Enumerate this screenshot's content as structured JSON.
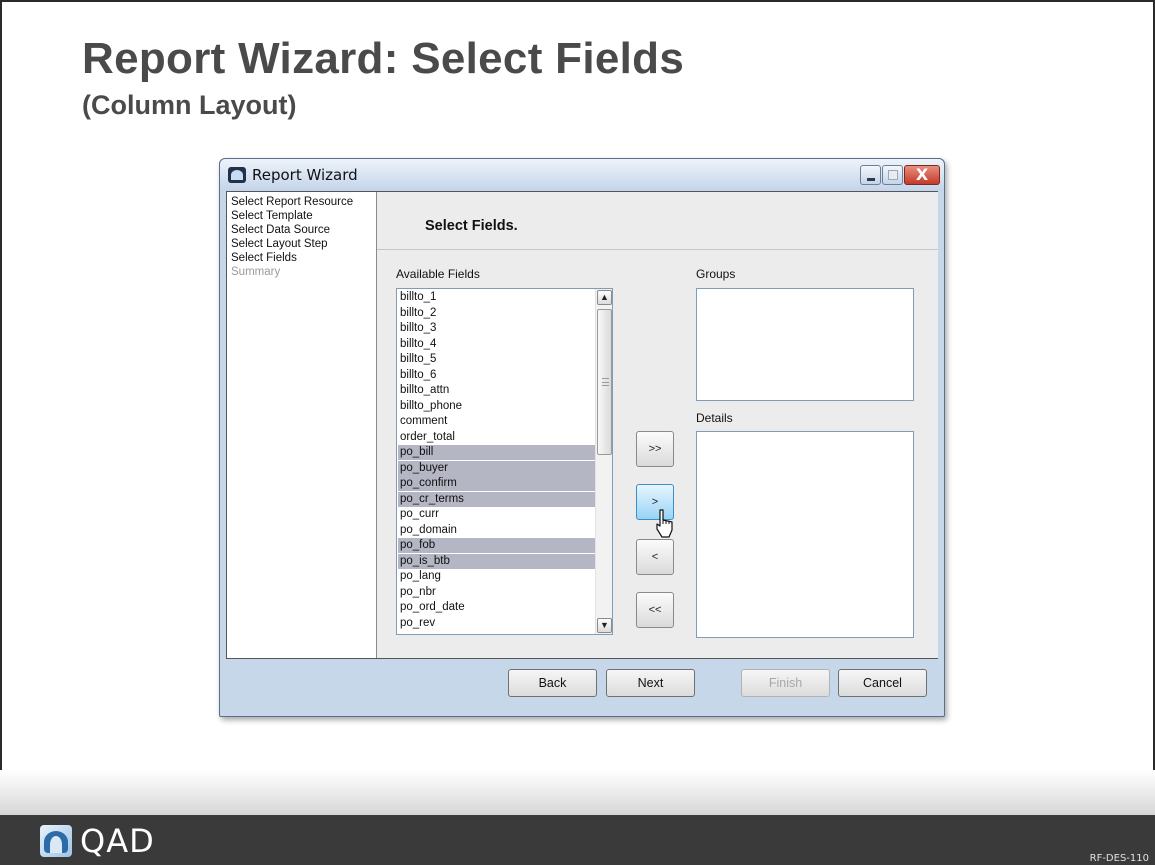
{
  "slide": {
    "title": "Report Wizard: Select Fields",
    "subtitle": "(Column Layout)",
    "logo_text": "QAD",
    "course_code": "RF-DES-110"
  },
  "window": {
    "title": "Report Wizard",
    "close_glyph": "X"
  },
  "steps": [
    {
      "label": "Select Report Resource",
      "enabled": true
    },
    {
      "label": "Select Template",
      "enabled": true
    },
    {
      "label": "Select Data Source",
      "enabled": true
    },
    {
      "label": "Select Layout Step",
      "enabled": true
    },
    {
      "label": "Select Fields",
      "enabled": true
    },
    {
      "label": "Summary",
      "enabled": false
    }
  ],
  "content": {
    "header_title": "Select Fields.",
    "available_label": "Available Fields",
    "groups_label": "Groups",
    "details_label": "Details"
  },
  "available_fields": [
    {
      "name": "billto_1",
      "selected": false
    },
    {
      "name": "billto_2",
      "selected": false
    },
    {
      "name": "billto_3",
      "selected": false
    },
    {
      "name": "billto_4",
      "selected": false
    },
    {
      "name": "billto_5",
      "selected": false
    },
    {
      "name": "billto_6",
      "selected": false
    },
    {
      "name": "billto_attn",
      "selected": false
    },
    {
      "name": "billto_phone",
      "selected": false
    },
    {
      "name": "comment",
      "selected": false
    },
    {
      "name": "order_total",
      "selected": false
    },
    {
      "name": "po_bill",
      "selected": true
    },
    {
      "name": "po_buyer",
      "selected": true
    },
    {
      "name": "po_confirm",
      "selected": true
    },
    {
      "name": "po_cr_terms",
      "selected": true
    },
    {
      "name": "po_curr",
      "selected": false
    },
    {
      "name": "po_domain",
      "selected": false
    },
    {
      "name": "po_fob",
      "selected": true
    },
    {
      "name": "po_is_btb",
      "selected": true
    },
    {
      "name": "po_lang",
      "selected": false
    },
    {
      "name": "po_nbr",
      "selected": false
    },
    {
      "name": "po_ord_date",
      "selected": false
    },
    {
      "name": "po_rev",
      "selected": false
    }
  ],
  "scrollbar": {
    "up_glyph": "▲",
    "down_glyph": "▼"
  },
  "move_buttons": {
    "add_all": ">>",
    "add": ">",
    "remove": "<",
    "remove_all": "<<"
  },
  "footer_buttons": {
    "back": "Back",
    "next": "Next",
    "finish": "Finish",
    "cancel": "Cancel"
  }
}
